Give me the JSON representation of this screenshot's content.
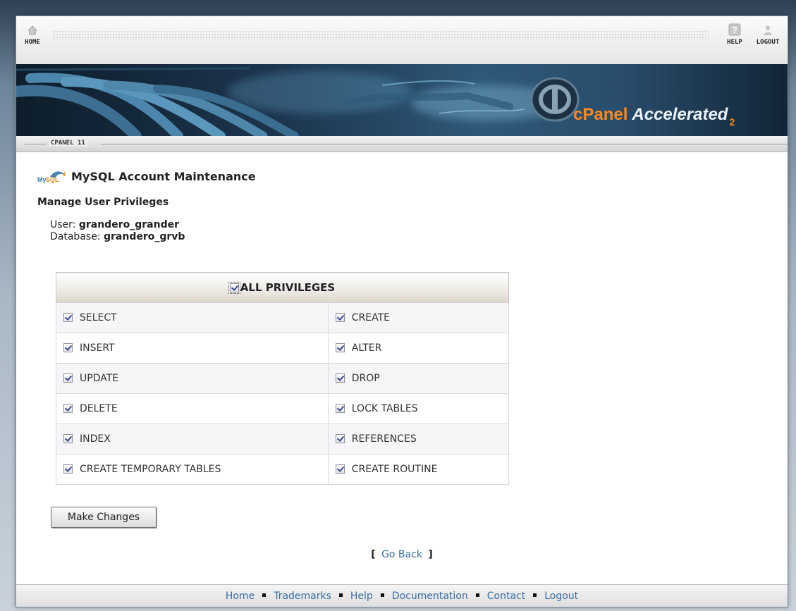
{
  "nav": {
    "home_label": "HOME",
    "help_label": "HELP",
    "logout_label": "LOGOUT"
  },
  "banner": {
    "brand_cpanel": "cPanel",
    "brand_accelerated": "Accelerated",
    "brand_version": "2"
  },
  "version_tag": "CPANEL 11",
  "page": {
    "title": "MySQL Account Maintenance",
    "subtitle": "Manage User Privileges",
    "user_label": "User:",
    "user_value": "grandero_grander",
    "database_label": "Database:",
    "database_value": "grandero_grvb"
  },
  "privileges": {
    "all_label": "ALL PRIVILEGES",
    "all_checked": true,
    "rows": [
      [
        "SELECT",
        "CREATE"
      ],
      [
        "INSERT",
        "ALTER"
      ],
      [
        "UPDATE",
        "DROP"
      ],
      [
        "DELETE",
        "LOCK TABLES"
      ],
      [
        "INDEX",
        "REFERENCES"
      ],
      [
        "CREATE TEMPORARY TABLES",
        "CREATE ROUTINE"
      ]
    ]
  },
  "actions": {
    "submit_label": "Make Changes",
    "go_back_open": "[",
    "go_back_label": "Go Back",
    "go_back_close": "]"
  },
  "footer": {
    "links": [
      "Home",
      "Trademarks",
      "Help",
      "Documentation",
      "Contact",
      "Logout"
    ]
  },
  "colors": {
    "link": "#3a6ea5",
    "brand_orange": "#ff8a1c"
  }
}
